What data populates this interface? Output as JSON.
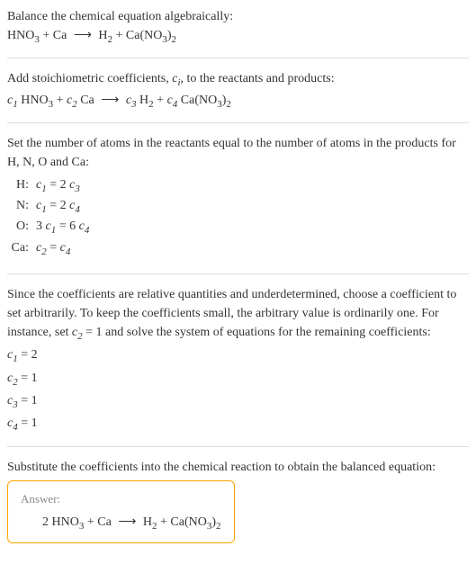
{
  "s1": {
    "intro": "Balance the chemical equation algebraically:",
    "eq_r1": "HNO",
    "eq_r1_sub": "3",
    "plus": " + ",
    "eq_r2": "Ca",
    "arrow": "⟶",
    "eq_p1": "H",
    "eq_p1_sub": "2",
    "eq_p2": "Ca(NO",
    "eq_p2_sub1": "3",
    "eq_p2_mid": ")",
    "eq_p2_sub2": "2"
  },
  "s2": {
    "line1a": "Add stoichiometric coefficients, ",
    "ci": "c",
    "ci_sub": "i",
    "line1b": ", to the reactants and products:",
    "c1": "c",
    "c1n": "1",
    "sp": " ",
    "r1": "HNO",
    "r1s": "3",
    "c2": "c",
    "c2n": "2",
    "r2": "Ca",
    "c3": "c",
    "c3n": "3",
    "p1": "H",
    "p1s": "2",
    "c4": "c",
    "c4n": "4",
    "p2": "Ca(NO",
    "p2s1": "3",
    "p2m": ")",
    "p2s2": "2"
  },
  "s3": {
    "intro": "Set the number of atoms in the reactants equal to the number of atoms in the products for H, N, O and Ca:",
    "rows": [
      {
        "label": "H:",
        "lhs_c": "c",
        "lhs_n": "1",
        "eq": " = 2 ",
        "rhs_c": "c",
        "rhs_n": "3"
      },
      {
        "label": "N:",
        "lhs_c": "c",
        "lhs_n": "1",
        "eq": " = 2 ",
        "rhs_c": "c",
        "rhs_n": "4"
      },
      {
        "label": "O:",
        "lhs_pre": "3 ",
        "lhs_c": "c",
        "lhs_n": "1",
        "eq": " = 6 ",
        "rhs_c": "c",
        "rhs_n": "4"
      },
      {
        "label": "Ca:",
        "lhs_c": "c",
        "lhs_n": "2",
        "eq": " = ",
        "rhs_c": "c",
        "rhs_n": "4"
      }
    ]
  },
  "s4": {
    "p1a": "Since the coefficients are relative quantities and underdetermined, choose a coefficient to set arbitrarily. To keep the coefficients small, the arbitrary value is ordinarily one. For instance, set ",
    "cv": "c",
    "cvs": "2",
    "p1b": " = 1 and solve the system of equations for the remaining coefficients:",
    "sol": [
      {
        "c": "c",
        "n": "1",
        "eq": " = 2"
      },
      {
        "c": "c",
        "n": "2",
        "eq": " = 1"
      },
      {
        "c": "c",
        "n": "3",
        "eq": " = 1"
      },
      {
        "c": "c",
        "n": "4",
        "eq": " = 1"
      }
    ]
  },
  "s5": {
    "intro": "Substitute the coefficients into the chemical reaction to obtain the balanced equation:",
    "answer_label": "Answer:",
    "two": "2 ",
    "r1": "HNO",
    "r1s": "3",
    "plus": " + ",
    "r2": "Ca",
    "arrow": "⟶",
    "p1": "H",
    "p1s": "2",
    "p2": "Ca(NO",
    "p2s1": "3",
    "p2m": ")",
    "p2s2": "2"
  }
}
